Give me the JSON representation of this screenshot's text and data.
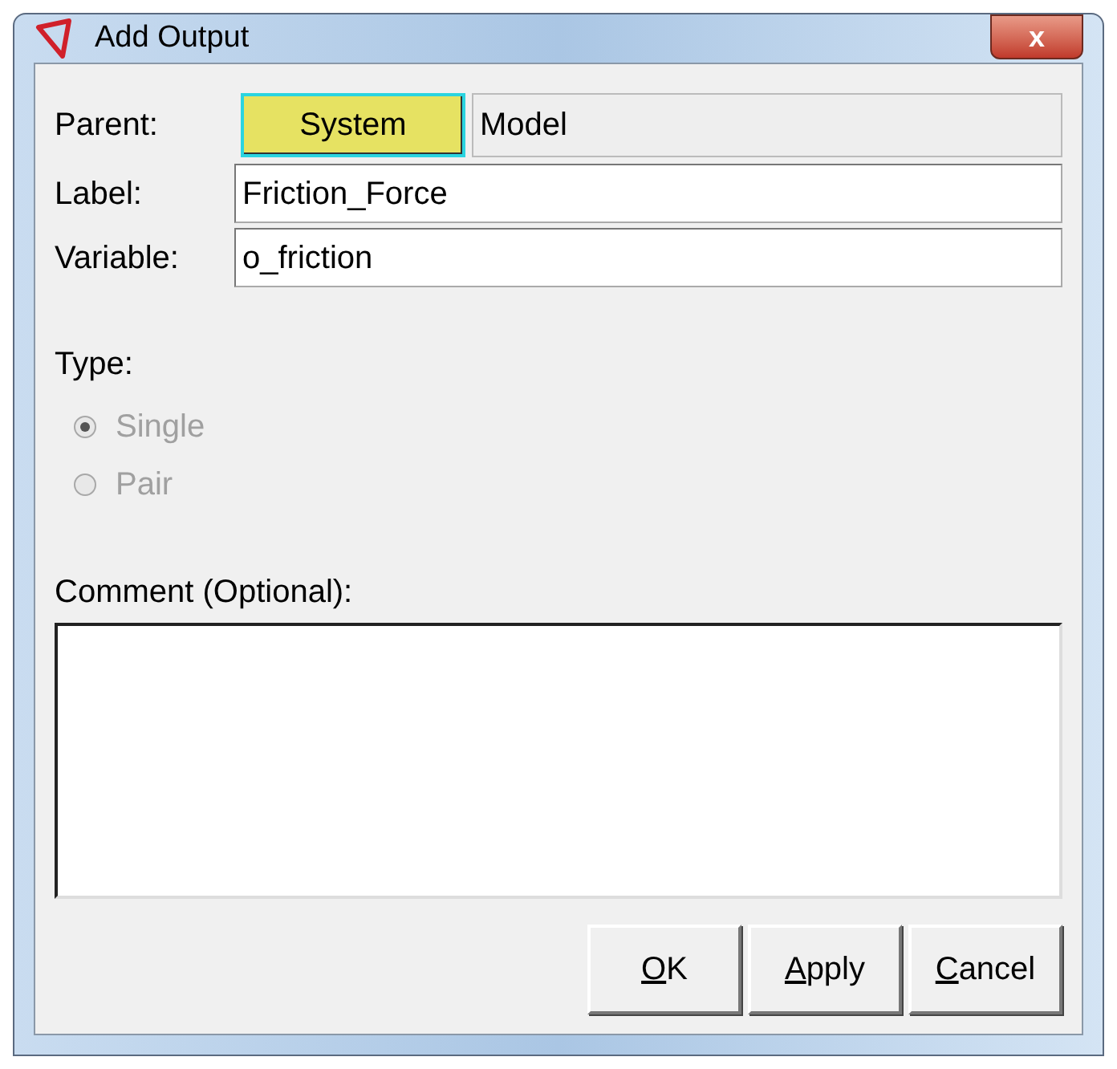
{
  "window": {
    "title": "Add Output",
    "close": "x"
  },
  "parent": {
    "label": "Parent:",
    "button": "System",
    "value": "Model"
  },
  "fields": [
    {
      "label": "Label:",
      "value": "Friction_Force"
    },
    {
      "label": "Variable:",
      "value": "o_friction"
    }
  ],
  "type": {
    "label": "Type:",
    "options": [
      {
        "label": "Single",
        "selected": true,
        "disabled": true
      },
      {
        "label": "Pair",
        "selected": false,
        "disabled": true
      }
    ]
  },
  "comment": {
    "label": "Comment (Optional):"
  },
  "buttons": [
    {
      "mnemonic": "O",
      "rest": "K"
    },
    {
      "mnemonic": "A",
      "rest": "pply"
    },
    {
      "mnemonic": "C",
      "rest": "ancel"
    }
  ]
}
